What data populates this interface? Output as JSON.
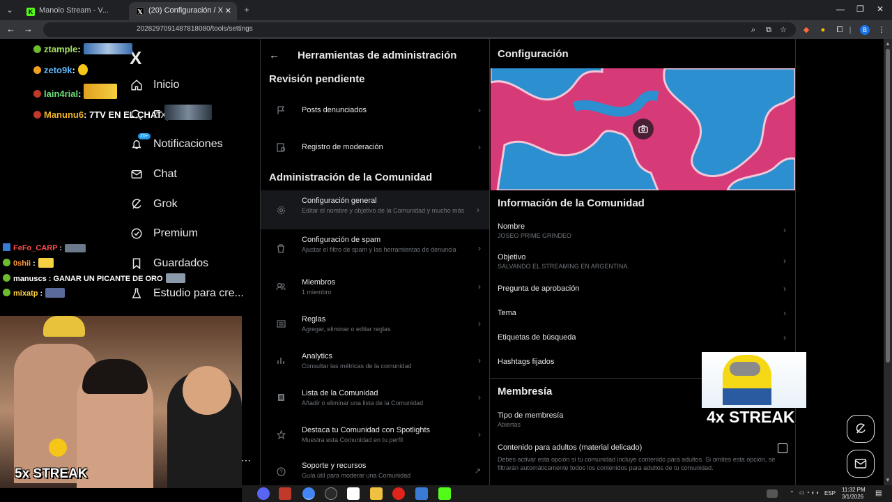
{
  "browser": {
    "tabs": [
      {
        "label": "Manolo Stream - V...",
        "icon": "kick-icon"
      },
      {
        "label": "(20) Configuración / X",
        "icon": "x-logo-icon"
      }
    ],
    "new_tab": "+",
    "url": "x.com/i/communities/2028297091487818080/tools/settings",
    "url_visible": "2028297091487818080/tools/settings",
    "window_controls": [
      "—",
      "❐",
      "✕"
    ],
    "profile_initial": "B"
  },
  "leftnav": {
    "logo": "X",
    "badge": "20+",
    "items": [
      {
        "label": "Inicio",
        "icon": "home-icon"
      },
      {
        "label": "Explorar",
        "icon": "search-icon"
      },
      {
        "label": "Notificaciones",
        "icon": "bell-icon"
      },
      {
        "label": "Chat",
        "icon": "mail-icon"
      },
      {
        "label": "Grok",
        "icon": "grok-icon"
      },
      {
        "label": "Premium",
        "icon": "verified-icon"
      },
      {
        "label": "Guardados",
        "icon": "bookmark-icon"
      },
      {
        "label": "Estudio para cre...",
        "icon": "creator-studio-icon"
      }
    ],
    "explore_visible": "Expl"
  },
  "tools": {
    "title": "Herramientas de administración",
    "section1": "Revisión pendiente",
    "section2": "Administración de la Comunidad",
    "pending": [
      {
        "label": "Posts denunciados",
        "icon": "flag-icon"
      },
      {
        "label": "Registro de moderación",
        "icon": "moderation-log-icon"
      }
    ],
    "admin": [
      {
        "label": "Configuración general",
        "sub": "Editar el nombre y objetivo de la Comunidad y mucho más",
        "icon": "gear-icon"
      },
      {
        "label": "Configuración de spam",
        "sub": "Ajustar el filtro de spam y las herramientas de denuncia",
        "icon": "trash-icon"
      },
      {
        "label": "Miembros",
        "sub": "1 miembro",
        "icon": "members-icon"
      },
      {
        "label": "Reglas",
        "sub": "Agregar, eliminar o editar reglas",
        "icon": "rules-icon"
      },
      {
        "label": "Analytics",
        "sub": "Consultar las métricas de la comunidad",
        "icon": "analytics-icon"
      },
      {
        "label": "Lista de la Comunidad",
        "sub": "Añadir o eliminar una lista de la Comunidad",
        "icon": "list-icon"
      },
      {
        "label": "Destaca tu Comunidad con Spotlights",
        "sub": "Muestra esta Comunidad en tu perfil",
        "icon": "star-icon"
      },
      {
        "label": "Soporte y recursos",
        "sub": "Guía útil para moderar una Comunidad",
        "icon": "help-icon"
      }
    ]
  },
  "config": {
    "title": "Configuración",
    "info_title": "Información de la Comunidad",
    "rows": [
      {
        "label": "Nombre",
        "value": "JOSEO PRIME GRINDEO"
      },
      {
        "label": "Objetivo",
        "value": "SALVANDO EL STREAMING EN ARGENTINA."
      },
      {
        "label": "Pregunta de aprobación",
        "value": ""
      },
      {
        "label": "Tema",
        "value": ""
      },
      {
        "label": "Etiquetas de búsqueda",
        "value": ""
      },
      {
        "label": "Hashtags fijados",
        "value": ""
      }
    ],
    "membership_title": "Membresía",
    "membership_type_label": "Tipo de membresía",
    "membership_type_value": "Abiertas",
    "adult_label": "Contenido para adultos (material delicado)",
    "adult_note": "Debes activar esta opción si tu comunidad incluye contenido para adultos. Si omites esta opción, se filtrarán automáticamente todos los contenidos para adultos de tu comunidad."
  },
  "stream": {
    "chat": [
      {
        "user": "ztample",
        "msg": "",
        "color": "#a8e063"
      },
      {
        "user": "zeto9k",
        "msg": "",
        "color": "#5bb7ff"
      },
      {
        "user": "lain4rial",
        "msg": "",
        "color": "#6ee07a"
      },
      {
        "user": "Manunu6",
        "msg": "7TV EN EL CHAT",
        "color": "#f0b429"
      }
    ],
    "chat2": [
      {
        "user": "FeFo_CARP",
        "msg": "",
        "color": "#ff4d4d"
      },
      {
        "user": "0shii",
        "msg": "",
        "color": "#ff9a3c"
      },
      {
        "user": "manuscs",
        "msg": "GANAR UN PICANTE DE ORO",
        "color": "#ffffff"
      },
      {
        "user": "mixatp",
        "msg": "",
        "color": "#ffd23f"
      }
    ],
    "streak_left": "5x STREAK",
    "streak_right": "4x STREAK"
  },
  "taskbar": {
    "lang": "ESP",
    "time": "11:32 PM",
    "date": "3/1/2026"
  }
}
